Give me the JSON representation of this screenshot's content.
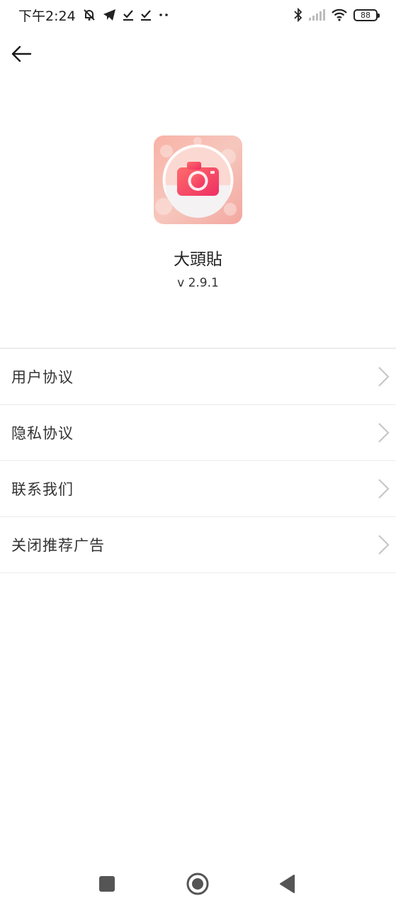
{
  "status_bar": {
    "time": "下午2:24",
    "battery": "88"
  },
  "app": {
    "name": "大頭貼",
    "version": "v 2.9.1"
  },
  "menu": [
    {
      "label": "用户协议"
    },
    {
      "label": "隐私协议"
    },
    {
      "label": "联系我们"
    },
    {
      "label": "关闭推荐广告"
    }
  ],
  "icons": {
    "back": "back-arrow-icon",
    "chevron": "chevron-right-icon",
    "nav_recent": "square-icon",
    "nav_home": "circle-home-icon",
    "nav_back": "triangle-back-icon"
  },
  "colors": {
    "accent": "#f2456a",
    "icon_bg": "#f7c1b8",
    "divider": "#ececec"
  }
}
